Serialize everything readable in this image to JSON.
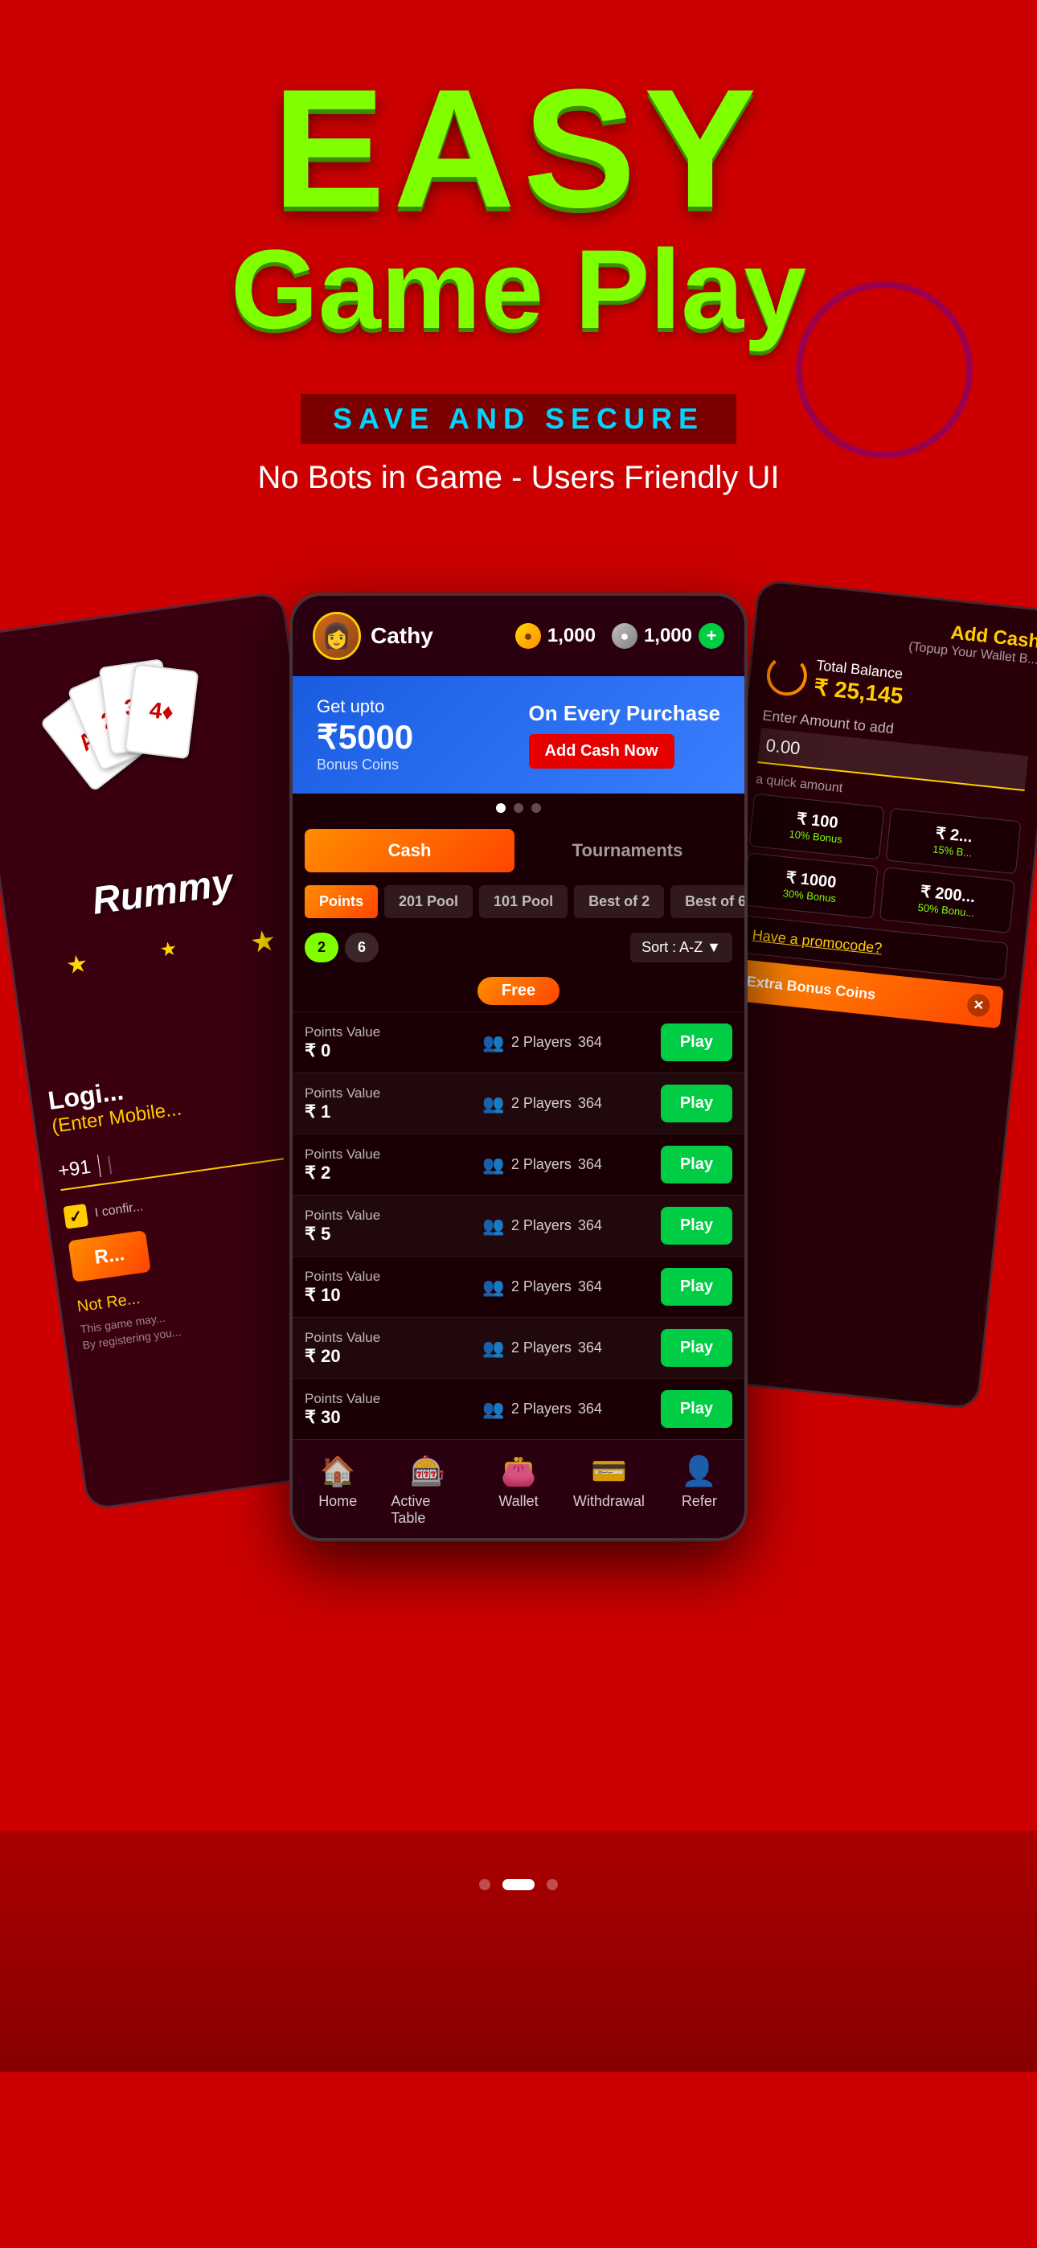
{
  "hero": {
    "easy_text": "EASY",
    "gameplay_text": "Game Play",
    "save_secure_text": "SAVE AND SECURE",
    "subtitle_text": "No Bots in Game - Users Friendly UI"
  },
  "phone": {
    "header": {
      "username": "Cathy",
      "gold_coins": "1,000",
      "silver_coins": "1,000"
    },
    "banner": {
      "get_upto": "Get upto",
      "amount": "₹5000",
      "bonus_coins": "Bonus Coins",
      "on_every": "On Every Purchase",
      "add_cash_label": "Add Cash Now"
    },
    "tabs": {
      "cash": "Cash",
      "tournaments": "Tournaments"
    },
    "filters": {
      "points": "Points",
      "pool_201": "201 Pool",
      "pool_101": "101 Pool",
      "best_of_2": "Best of 2",
      "best_of_6": "Best of 6"
    },
    "player_filters": {
      "p2": "2",
      "p6": "6"
    },
    "sort_label": "Sort : A-Z",
    "free_badge": "Free",
    "game_rows": [
      {
        "label": "Points Value",
        "value": "₹ 0",
        "players": "2 Players",
        "count": "364",
        "play": "Play"
      },
      {
        "label": "Points Value",
        "value": "₹ 1",
        "players": "2 Players",
        "count": "364",
        "play": "Play"
      },
      {
        "label": "Points Value",
        "value": "₹ 2",
        "players": "2 Players",
        "count": "364",
        "play": "Play"
      },
      {
        "label": "Points Value",
        "value": "₹ 5",
        "players": "2 Players",
        "count": "364",
        "play": "Play"
      },
      {
        "label": "Points Value",
        "value": "₹ 10",
        "players": "2 Players",
        "count": "364",
        "play": "Play"
      },
      {
        "label": "Points Value",
        "value": "₹ 20",
        "players": "2 Players",
        "count": "364",
        "play": "Play"
      },
      {
        "label": "Points Value",
        "value": "₹ 30",
        "players": "2 Players",
        "count": "364",
        "play": "Play"
      }
    ],
    "nav": {
      "home": "Home",
      "active_table": "Active Table",
      "wallet": "Wallet",
      "withdrawal": "Withdrawal",
      "refer": "Refer"
    }
  },
  "right_screen": {
    "add_cash_title": "Add Cash",
    "topup_subtitle": "(Topup Your Wallet B...",
    "total_balance_label": "Total Balance",
    "total_balance_amount": "₹ 25,145",
    "enter_amount_label": "Enter Amount to add",
    "amount_value": "0.00",
    "quick_label": "a quick amount",
    "amounts": [
      {
        "value": "₹ 100",
        "bonus": "10% Bonus"
      },
      {
        "value": "₹ 2...",
        "bonus": "15% B..."
      },
      {
        "value": "₹ 1000",
        "bonus": "30% Bonus"
      },
      {
        "value": "₹ 200...",
        "bonus": "50% Bonu..."
      }
    ],
    "promo_label": "Have a promocode?",
    "extra_bonus_label": "Extra Bonus Coins"
  },
  "left_screen": {
    "rummy_text": "Rummy",
    "login_title": "Logi...",
    "login_subtitle": "(Enter Mobile...",
    "country_code": "+91",
    "not_registered": "Not Re...",
    "small_text1": "This game may...",
    "small_text2": "By registering you..."
  }
}
